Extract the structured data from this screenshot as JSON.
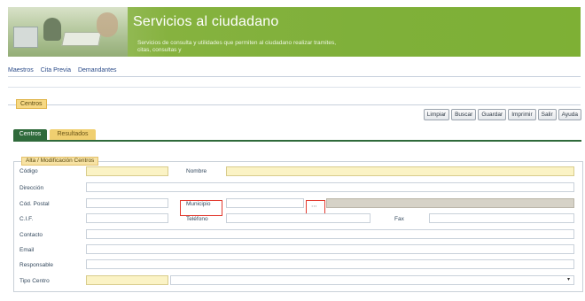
{
  "header": {
    "title": "Servicios al ciudadano",
    "subtitle": "Servicios de consulta y utilidades que permiten al ciudadano realizar tramites, citas, consultas y"
  },
  "menu": {
    "items": [
      "Maestros",
      "Cita Previa",
      "Demandantes"
    ]
  },
  "section": {
    "legend": "Centros"
  },
  "toolbar": {
    "buttons": [
      "Limpiar",
      "Buscar",
      "Guardar",
      "Imprimir",
      "Salir",
      "Ayuda"
    ]
  },
  "tabs": [
    {
      "label": "Centros",
      "active": true
    },
    {
      "label": "Resultados",
      "active": false
    }
  ],
  "form": {
    "legend": "Alta / Modificación Centros",
    "fields": {
      "codigo": {
        "label": "Código",
        "value": ""
      },
      "nombre": {
        "label": "Nombre",
        "value": ""
      },
      "direccion": {
        "label": "Dirección",
        "value": ""
      },
      "cod_postal": {
        "label": "Cód. Postal",
        "value": ""
      },
      "municipio": {
        "label": "Municipio",
        "value": ""
      },
      "cif": {
        "label": "C.I.F.",
        "value": ""
      },
      "telefono": {
        "label": "Teléfono",
        "value": ""
      },
      "fax": {
        "label": "Fax",
        "value": ""
      },
      "contacto": {
        "label": "Contacto",
        "value": ""
      },
      "email": {
        "label": "Email",
        "value": ""
      },
      "responsable": {
        "label": "Responsable",
        "value": ""
      },
      "tipo_centro": {
        "label": "Tipo Centro",
        "value": ""
      }
    }
  },
  "icons": {
    "browse": "ellipsis-icon",
    "dropdown": "chevron-down-icon"
  },
  "colors": {
    "banner_green": "#7fb03a",
    "tab_active": "#2f6a3b",
    "tab_inactive": "#f0cf70",
    "required_field": "#fbf3c5",
    "highlight_red": "#e23a2f"
  }
}
